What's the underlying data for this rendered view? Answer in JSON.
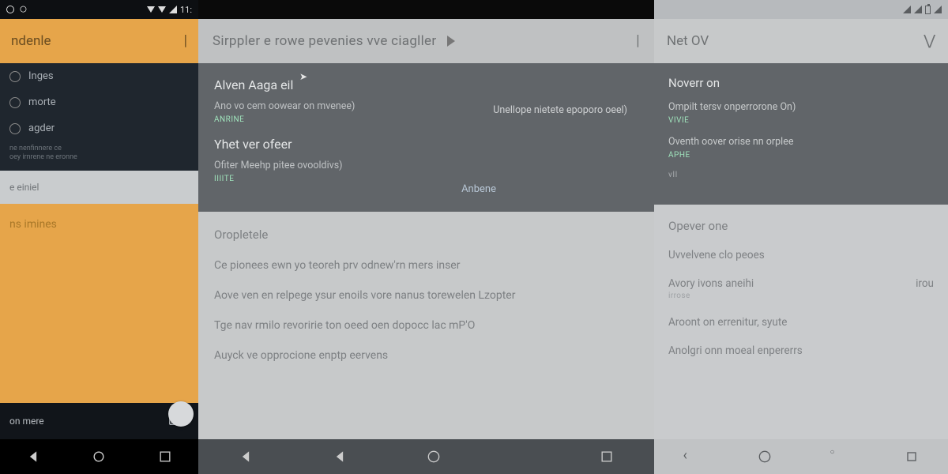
{
  "p1": {
    "status_time": "11:",
    "appbar_title": "ndenle",
    "rows": [
      {
        "label": "Inges"
      },
      {
        "label": "morte"
      },
      {
        "label": "agder"
      }
    ],
    "hint_line1": "ne nenfinnere ce",
    "hint_line2": "oey irnrene ne eronne",
    "lightbox_label": "e einiel",
    "filler_label": "ns imines",
    "footer_label": "on mere"
  },
  "p2": {
    "appbar_title": "Sirppler e rowe pevenies vve ciagller",
    "dialog": {
      "title1": "Alven Aaga eil",
      "sub1": "Ano vo cem oowear on mvenee)",
      "tag1": "ANRINE",
      "right_text": "Unellope nietete epoporo oeel)",
      "title2": "Yhet ver ofeer",
      "sub2": "Ofiter Meehp pitee ovooldivs)",
      "tag2": "IIIITE",
      "action": "Anbene"
    },
    "list": {
      "header": "Oropletele",
      "items": [
        "Ce pionees ewn yo teoreh prv odnew'rn mers inser",
        "Aove ven en relpege ysur enoils vore nanus torewelen Lzopter",
        "Tge nav rmilo revoririe ton oeed oen dopocc lac mP'O",
        "Auyck ve opprocione enptp eervens"
      ]
    }
  },
  "p3": {
    "appbar_title": "Net OV",
    "dark": {
      "title": "Noverr on",
      "line1": "Ompilt tersv onperrorone On)",
      "tag1": "VIVIE",
      "line2": "Oventh oover orise nn orplee",
      "tag2": "APHE",
      "tag3": "vII"
    },
    "list": {
      "header": "Opever one",
      "items": [
        {
          "label": "Uvvelvene clo peoes"
        },
        {
          "label": "Avory ivons aneihi",
          "trail": "irou",
          "sub": "irrose"
        },
        {
          "label": "Aroont on errenitur, syute"
        },
        {
          "label": "Anolgri onn moeal enpererrs"
        }
      ]
    }
  }
}
